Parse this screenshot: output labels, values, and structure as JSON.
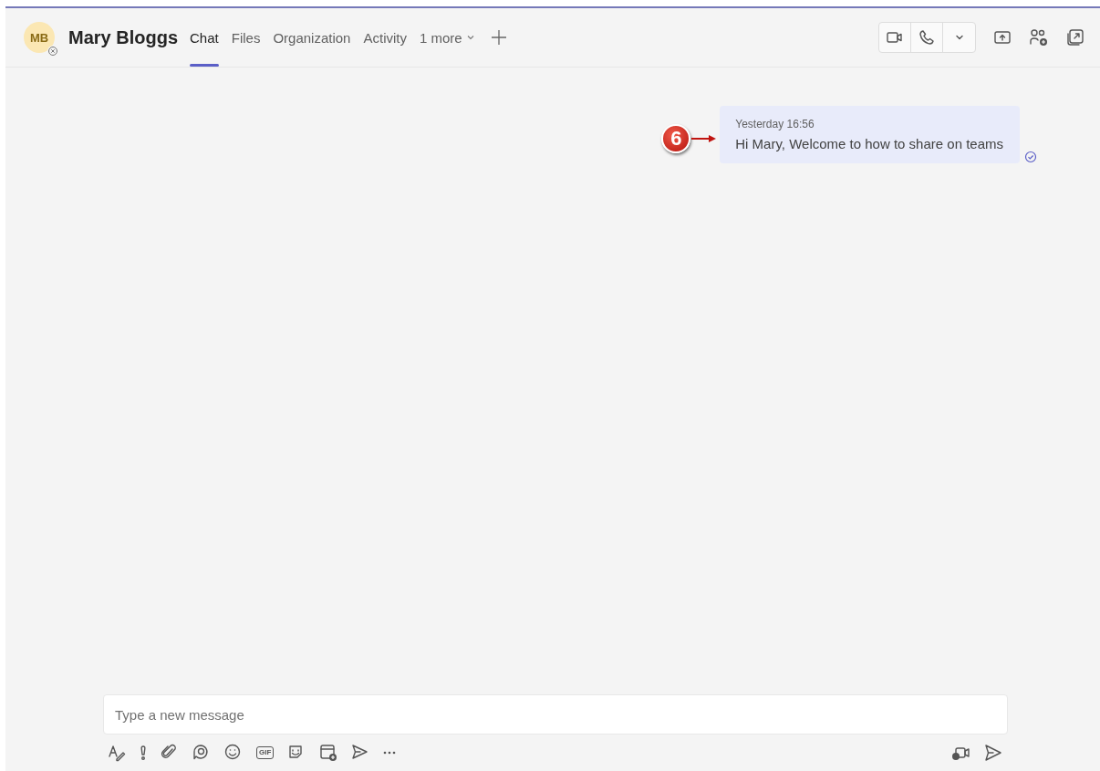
{
  "header": {
    "avatar_initials": "MB",
    "name": "Mary Bloggs",
    "tabs": [
      {
        "label": "Chat",
        "selected": true
      },
      {
        "label": "Files",
        "selected": false
      },
      {
        "label": "Organization",
        "selected": false
      },
      {
        "label": "Activity",
        "selected": false
      },
      {
        "label": "1 more",
        "selected": false,
        "kind": "more"
      }
    ]
  },
  "messages": [
    {
      "time": "Yesterday 16:56",
      "text": "Hi Mary, Welcome to how to share on teams",
      "seen": true,
      "callout": "6"
    }
  ],
  "composer": {
    "placeholder": "Type a new message",
    "gif_label": "GIF"
  }
}
